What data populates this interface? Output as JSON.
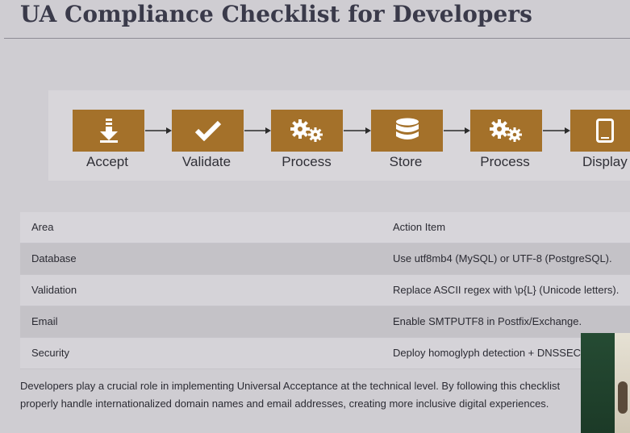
{
  "page": {
    "title": "UA Compliance Checklist for Developers"
  },
  "flow": {
    "accent_color": "#a4712a",
    "steps": [
      {
        "label": "Accept",
        "icon": "download-arrow-icon"
      },
      {
        "label": "Validate",
        "icon": "checkmark-icon"
      },
      {
        "label": "Process",
        "icon": "gears-icon"
      },
      {
        "label": "Store",
        "icon": "database-icon"
      },
      {
        "label": "Process",
        "icon": "gears-icon"
      },
      {
        "label": "Display",
        "icon": "tablet-icon"
      }
    ]
  },
  "table": {
    "headers": {
      "area": "Area",
      "action": "Action Item"
    },
    "rows": [
      {
        "area": "Database",
        "action": "Use utf8mb4 (MySQL) or UTF-8 (PostgreSQL)."
      },
      {
        "area": "Validation",
        "action": "Replace ASCII regex with \\p{L} (Unicode letters)."
      },
      {
        "area": "Email",
        "action": "Enable SMTPUTF8 in Postfix/Exchange."
      },
      {
        "area": "Security",
        "action": "Deploy homoglyph detection + DNSSEC"
      }
    ]
  },
  "summary": {
    "line1": "Developers play a crucial role in implementing Universal Acceptance at the technical level. By following this checklist",
    "line2": "properly handle internationalized domain names and email addresses, creating more inclusive digital experiences."
  }
}
